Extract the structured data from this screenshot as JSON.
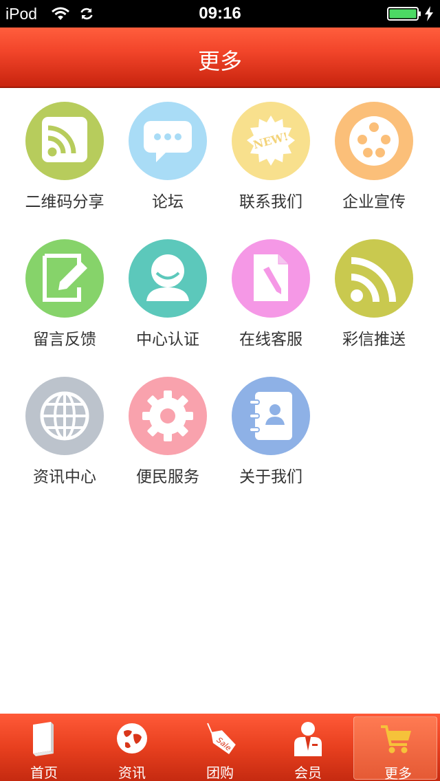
{
  "status_bar": {
    "carrier": "iPod",
    "time": "09:16"
  },
  "header": {
    "title": "更多"
  },
  "grid": {
    "items": [
      {
        "label": "二维码分享",
        "icon": "rss-square-icon",
        "color": "#b7cc5c"
      },
      {
        "label": "论坛",
        "icon": "chat-bubble-icon",
        "color": "#a9dcf6"
      },
      {
        "label": "联系我们",
        "icon": "new-badge-icon",
        "color": "#f8e08d"
      },
      {
        "label": "企业宣传",
        "icon": "film-reel-icon",
        "color": "#fbbf79"
      },
      {
        "label": "留言反馈",
        "icon": "edit-note-icon",
        "color": "#86d36a"
      },
      {
        "label": "中心认证",
        "icon": "user-icon",
        "color": "#5cc8bb"
      },
      {
        "label": "在线客服",
        "icon": "document-pen-icon",
        "color": "#f598e6"
      },
      {
        "label": "彩信推送",
        "icon": "rss-feed-icon",
        "color": "#c9c94f"
      },
      {
        "label": "资讯中心",
        "icon": "globe-icon",
        "color": "#bcc3cc"
      },
      {
        "label": "便民服务",
        "icon": "gear-icon",
        "color": "#f9a2ad"
      },
      {
        "label": "关于我们",
        "icon": "contacts-book-icon",
        "color": "#8eb1e6"
      }
    ]
  },
  "tab_bar": {
    "tabs": [
      {
        "label": "首页",
        "icon": "book-icon"
      },
      {
        "label": "资讯",
        "icon": "globe-icon"
      },
      {
        "label": "团购",
        "icon": "sale-tag-icon"
      },
      {
        "label": "会员",
        "icon": "member-icon"
      },
      {
        "label": "更多",
        "icon": "shopping-cart-icon",
        "active": true
      }
    ]
  },
  "colors": {
    "accent": "#e8401f",
    "nav_gradient_top": "#ff5e3d",
    "nav_gradient_bottom": "#c8240e",
    "label_text": "#333333"
  }
}
